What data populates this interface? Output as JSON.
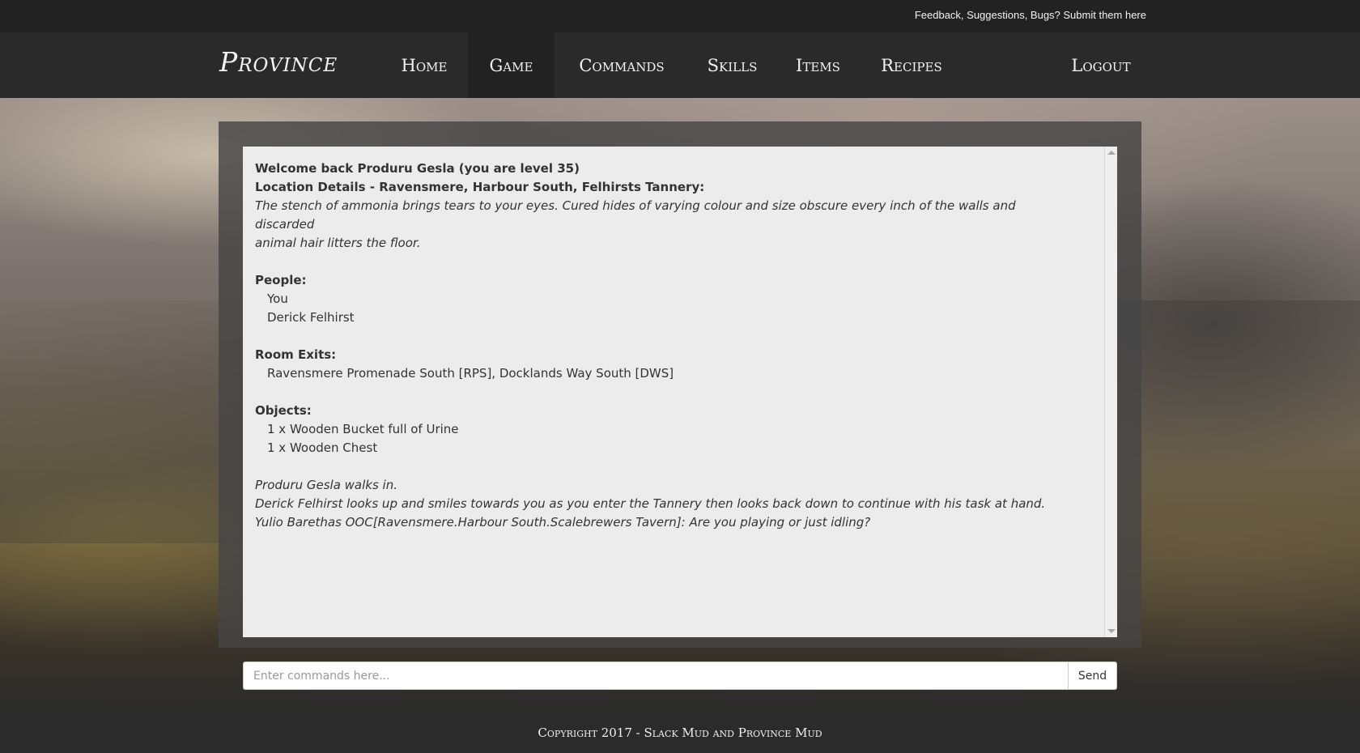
{
  "topbar": {
    "feedback_link": "Feedback, Suggestions, Bugs? Submit them here"
  },
  "brand": {
    "logo": "Province"
  },
  "nav": {
    "home": "Home",
    "game": "Game",
    "commands": "Commands",
    "skills": "Skills",
    "items": "Items",
    "recipes": "Recipes",
    "logout": "Logout",
    "active": "Game"
  },
  "output": {
    "welcome": "Welcome back Produru Gesla (you are level 35)",
    "location": "Location Details - Ravensmere, Harbour South, Felhirsts Tannery:",
    "description_1": "The stench of ammonia brings tears to your eyes. Cured hides of varying colour and size obscure every inch of the walls and discarded",
    "description_2": "animal hair litters the floor.",
    "people_heading": "People:",
    "people": [
      "You",
      "Derick Felhirst"
    ],
    "exits_heading": "Room Exits:",
    "exits": "Ravensmere Promenade South [RPS], Docklands Way South [DWS]",
    "objects_heading": "Objects:",
    "objects": [
      "1 x Wooden Bucket full of Urine",
      "1 x Wooden Chest"
    ],
    "messages": [
      "Produru Gesla walks in.",
      "Derick Felhirst looks up and smiles towards you as you enter the Tannery then looks back down to continue with his task at hand.",
      "Yulio Barethas OOC[Ravensmere.Harbour South.Scalebrewers Tavern]: Are you playing or just idling?"
    ]
  },
  "command": {
    "placeholder": "Enter commands here...",
    "value": "",
    "send_label": "Send"
  },
  "footer": {
    "copyright": "Copyright 2017 - Slack Mud and Province Mud"
  }
}
